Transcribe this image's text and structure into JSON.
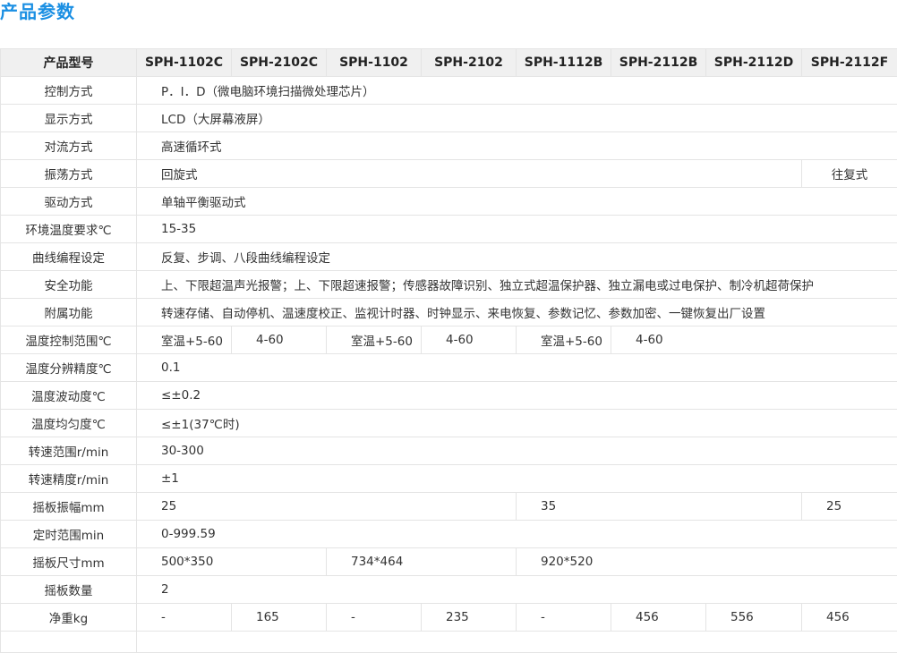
{
  "title": "产品参数",
  "header": {
    "param": "产品型号",
    "models": [
      "SPH-1102C",
      "SPH-2102C",
      "SPH-1102",
      "SPH-2102",
      "SPH-1112B",
      "SPH-2112B",
      "SPH-2112D",
      "SPH-2112F"
    ]
  },
  "rows": {
    "control": {
      "label": "控制方式",
      "value": "P．I．D（微电脑环境扫描微处理芯片）"
    },
    "display": {
      "label": "显示方式",
      "value": "LCD（大屏幕液屏）"
    },
    "convection": {
      "label": "对流方式",
      "value": "高速循环式"
    },
    "oscillation": {
      "label": "振荡方式",
      "value_a": "回旋式",
      "value_b": "往复式"
    },
    "drive": {
      "label": "驱动方式",
      "value": "单轴平衡驱动式"
    },
    "env_temp": {
      "label": "环境温度要求℃",
      "value": "15-35"
    },
    "curve": {
      "label": "曲线编程设定",
      "value": "反复、步调、八段曲线编程设定"
    },
    "safety": {
      "label": "安全功能",
      "value": "上、下限超温声光报警；上、下限超速报警；传感器故障识别、独立式超温保护器、独立漏电或过电保护、制冷机超荷保护"
    },
    "extra": {
      "label": "附属功能",
      "value": "转速存储、自动停机、温速度校正、监视计时器、时钟显示、来电恢复、参数记忆、参数加密、一键恢复出厂设置"
    },
    "temp_range": {
      "label": "温度控制范围℃",
      "values": [
        "室温+5-60",
        "4-60",
        "室温+5-60",
        "4-60",
        "室温+5-60",
        "4-60"
      ]
    },
    "temp_res": {
      "label": "温度分辨精度℃",
      "value": "0.1"
    },
    "temp_fluct": {
      "label": "温度波动度℃",
      "value": "≤±0.2"
    },
    "temp_unif": {
      "label": "温度均匀度℃",
      "value": "≤±1(37℃时)"
    },
    "speed_range": {
      "label": "转速范围r/min",
      "value": "30-300"
    },
    "speed_prec": {
      "label": "转速精度r/min",
      "value": "±1"
    },
    "amplitude": {
      "label": "摇板振幅mm",
      "values": [
        "25",
        "35",
        "25"
      ]
    },
    "timer": {
      "label": "定时范围min",
      "value": "0-999.59"
    },
    "plate_size": {
      "label": "摇板尺寸mm",
      "values": [
        "500*350",
        "734*464",
        "920*520"
      ]
    },
    "plate_qty": {
      "label": "摇板数量",
      "value": "2"
    },
    "net_weight": {
      "label": "净重kg",
      "values": [
        "-",
        "165",
        "-",
        "235",
        "-",
        "456",
        "556",
        "456"
      ]
    },
    "clipped": {
      "label": "",
      "value": ""
    }
  }
}
